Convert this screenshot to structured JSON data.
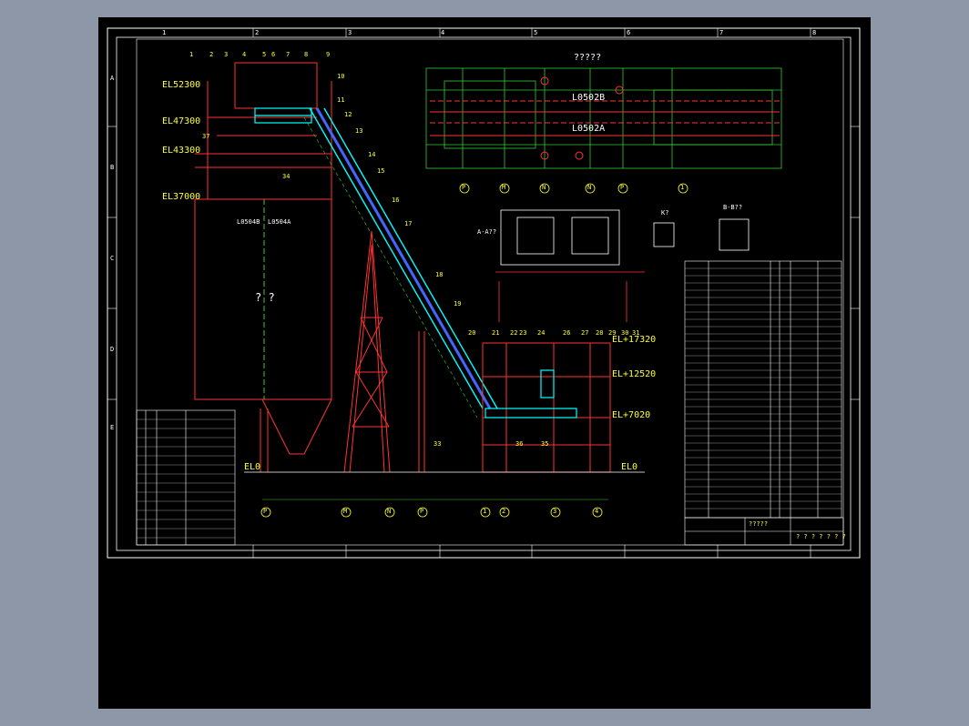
{
  "drawing": {
    "elevations": {
      "el52300": "EL52300",
      "el47300": "EL47300",
      "el43300": "EL43300",
      "el37000": "EL37000",
      "el17320": "EL+17320",
      "el12520": "EL+12520",
      "el7020": "EL+7020",
      "el0_left": "EL0",
      "el0_right": "EL0"
    },
    "equipment_labels": {
      "l0502b": "L0502B",
      "l0502a": "L0502A",
      "l0504b": "L0504B",
      "l0504a": "L0504A",
      "plan_title": "?????",
      "silo_mark": "? ?",
      "section_a": "A-A??",
      "view_k": "K?",
      "section_b": "B-B??"
    },
    "callouts": [
      "1",
      "2",
      "3",
      "4",
      "5",
      "6",
      "7",
      "8",
      "9",
      "10",
      "11",
      "12",
      "13",
      "14",
      "15",
      "16",
      "17",
      "18",
      "19",
      "20",
      "21",
      "22",
      "23",
      "24",
      "26",
      "27",
      "28",
      "29",
      "30",
      "31",
      "33",
      "34",
      "35",
      "36",
      "37"
    ],
    "axis_labels_bottom": [
      "P",
      "M",
      "N",
      "P",
      "1",
      "2",
      "3",
      "4"
    ],
    "axis_labels_plan": [
      "P",
      "M",
      "N",
      "N",
      "P",
      "1"
    ],
    "border_numbers_top": [
      "1",
      "2",
      "3",
      "4",
      "5",
      "6",
      "7",
      "8"
    ],
    "border_letters_left": [
      "A",
      "B",
      "C",
      "D",
      "E"
    ],
    "title_block": {
      "scale_note": "?????",
      "drawing_no": "? ? ? ? ? ? ?"
    },
    "colors": {
      "background": "#000000",
      "frame": "#ffffff",
      "text": "#ffff33",
      "structure": "#ff3333",
      "conveyor": "#00ffff",
      "plan": "#33cc33",
      "belt": "#4466ff"
    }
  }
}
